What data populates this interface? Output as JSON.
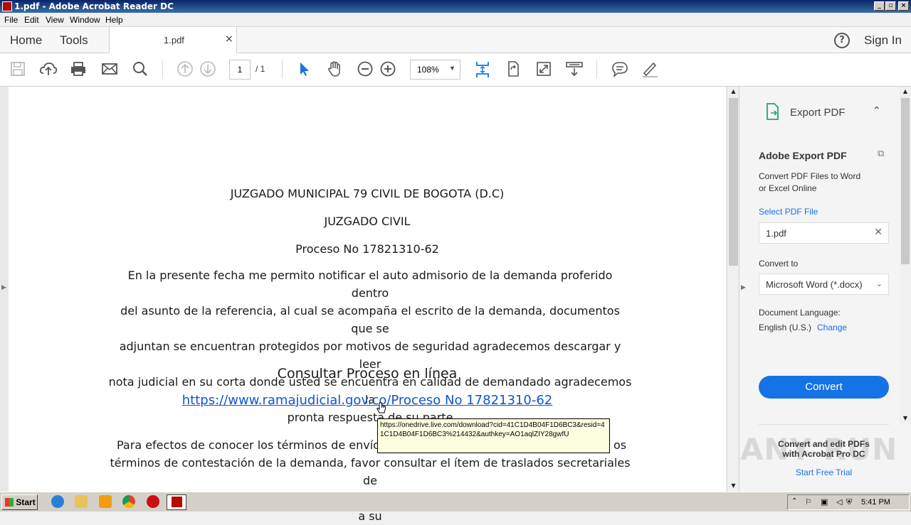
{
  "window": {
    "title": "1.pdf - Adobe Acrobat Reader DC",
    "controls": [
      "_",
      "▫",
      "×"
    ]
  },
  "menu": [
    "File",
    "Edit",
    "View",
    "Window",
    "Help"
  ],
  "tabs": {
    "home": "Home",
    "tools": "Tools",
    "document": "1.pdf",
    "close": "×",
    "signin": "Sign In",
    "help": "?"
  },
  "toolbar": {
    "page_current": "1",
    "page_total": "/ 1",
    "zoom": "108%"
  },
  "document": {
    "line1": "JUZGADO MUNICIPAL 79 CIVIL DE BOGOTA (D.C)",
    "line2": "JUZGADO CIVIL",
    "line3": "Proceso No 17821310-62",
    "paragraph1_lines": [
      "En la presente fecha me permito notificar el auto admisorio de la demanda proferido dentro",
      "del asunto de la referencia, al cual se acompaña el escrito de la demanda, documentos que se",
      "adjuntan se encuentran protegidos por motivos de seguridad agradecemos descargar y leer",
      "nota judicial en su corta donde usted se encuentra en calidad de demandado agradecemos la",
      "pronta respuesta de su parte"
    ],
    "heading": "Consultar Proceso en línea",
    "link": "https://www.ramajudicial.gov.co/Proceso No 17821310-62",
    "paragraph2_lines": [
      "Para efectos de conocer los términos de envío f",
      "os",
      "términos de contestación de la demanda, favor consultar el ítem de traslados secretariales de",
      "la página web de la Rama Judicial o la carpeta de traslados secretariales que se encuentra a su"
    ],
    "tooltip": "https://onedrive.live.com/download?cid=41C1D4B04F1D6BC3&resid=41C1D4B04F1D6BC3%214432&authkey=AO1aqlZIY28gwfU"
  },
  "right_pane": {
    "export_title": "Export PDF",
    "adobe_export": "Adobe Export PDF",
    "description_lines": [
      "Convert PDF Files to Word",
      "or Excel Online"
    ],
    "select_label": "Select PDF File",
    "selected_file": "1.pdf",
    "convert_to_label": "Convert to",
    "convert_option": "Microsoft Word (*.docx)",
    "doc_language_label": "Document Language:",
    "language": "English (U.S.)",
    "change": "Change",
    "convert_button": "Convert",
    "promo_lines": [
      "Convert and edit PDFs",
      "with Acrobat Pro DC"
    ],
    "trial": "Start Free Trial",
    "accent_color": "#1473e6"
  },
  "taskbar": {
    "start": "Start",
    "clock": "5:41 PM"
  },
  "watermark": "ANY RUN"
}
